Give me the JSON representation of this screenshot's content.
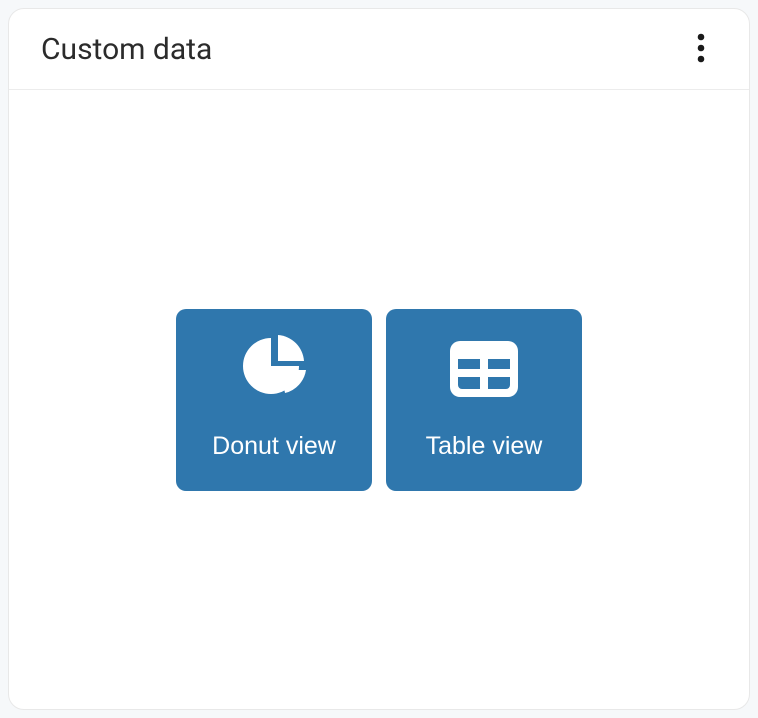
{
  "panel": {
    "title": "Custom data"
  },
  "tiles": {
    "donut": {
      "label": "Donut view",
      "icon": "pie-chart-icon"
    },
    "table": {
      "label": "Table view",
      "icon": "table-icon"
    }
  },
  "colors": {
    "tile_bg": "#2f77ad",
    "tile_fg": "#ffffff",
    "card_bg": "#ffffff",
    "border": "#e8e8e8"
  }
}
